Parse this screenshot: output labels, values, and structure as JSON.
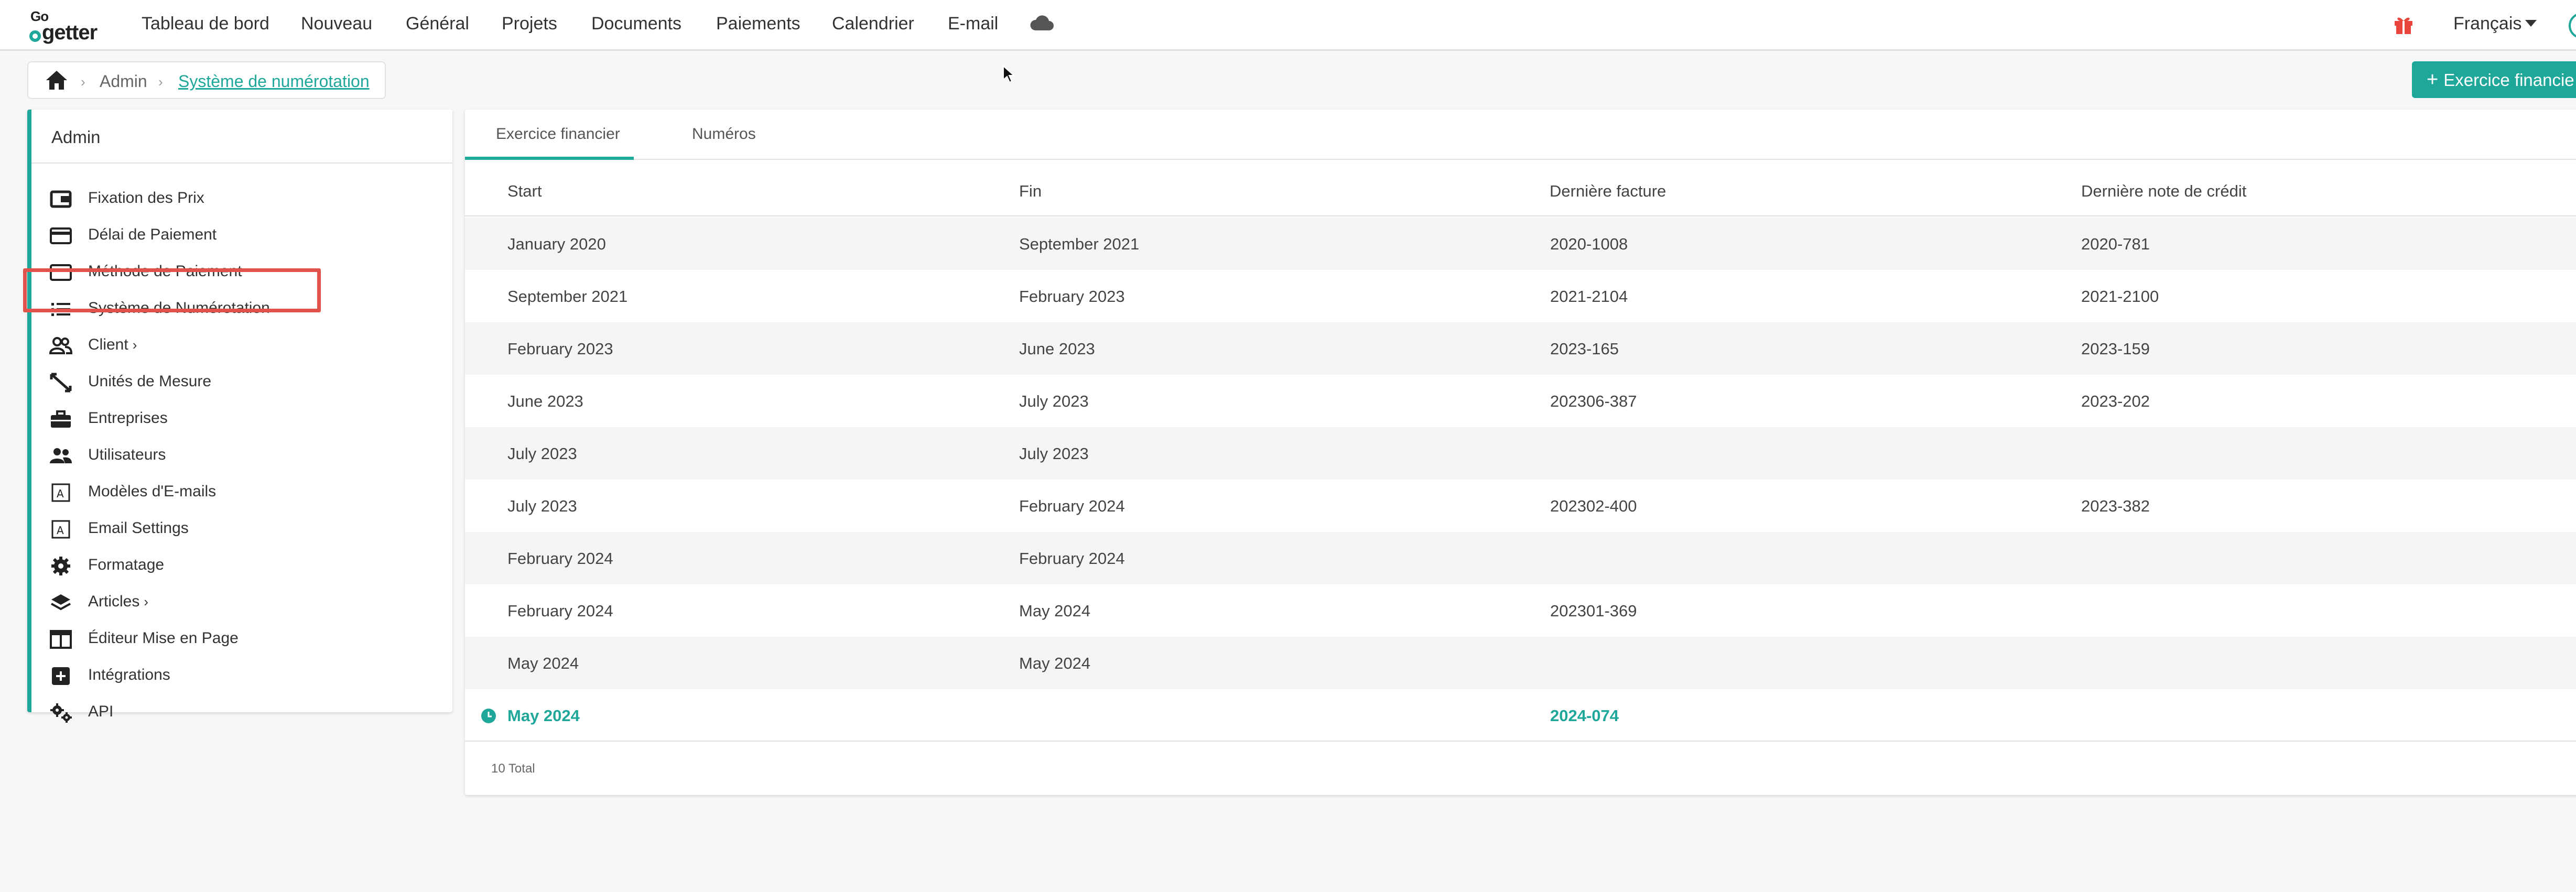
{
  "app": {
    "logo_top": "Go",
    "logo_bottom": "getter"
  },
  "nav": {
    "items": [
      "Tableau de bord",
      "Nouveau",
      "Général",
      "Projets",
      "Documents",
      "Paiements",
      "Calendrier",
      "E-mail"
    ],
    "cloud_icon": "cloud-icon",
    "gift_icon": "gift-icon",
    "language": "Français"
  },
  "breadcrumb": {
    "home_icon": "home-icon",
    "admin": "Admin",
    "current": "Système de numérotation"
  },
  "actions": {
    "new_fiscal_year": "Exercice financie"
  },
  "sidebar": {
    "title": "Admin",
    "items": [
      {
        "label": "Fixation des Prix",
        "icon": "wallet-icon"
      },
      {
        "label": "Délai de Paiement",
        "icon": "credit-card-icon"
      },
      {
        "label": "Méthode de Paiement",
        "icon": "credit-card-icon"
      },
      {
        "label": "Système de Numérotation",
        "icon": "list-icon"
      },
      {
        "label": "Client",
        "icon": "users-icon",
        "chevron": "›"
      },
      {
        "label": "Unités de Mesure",
        "icon": "ruler-icon"
      },
      {
        "label": "Entreprises",
        "icon": "briefcase-icon"
      },
      {
        "label": "Utilisateurs",
        "icon": "group-icon"
      },
      {
        "label": "Modèles d'E-mails",
        "icon": "template-icon"
      },
      {
        "label": "Email Settings",
        "icon": "template-icon"
      },
      {
        "label": "Formatage",
        "icon": "gear-icon"
      },
      {
        "label": "Articles",
        "icon": "layers-icon",
        "chevron": "›"
      },
      {
        "label": "Éditeur Mise en Page",
        "icon": "layout-icon"
      },
      {
        "label": "Intégrations",
        "icon": "plus-square-icon"
      },
      {
        "label": "API",
        "icon": "gears-icon"
      }
    ],
    "highlight_color": "#e0534a"
  },
  "main": {
    "tabs": [
      "Exercice financier",
      "Numéros"
    ],
    "columns": [
      "Start",
      "Fin",
      "Dernière facture",
      "Dernière note de crédit"
    ],
    "rows": [
      [
        "January 2020",
        "September 2021",
        "2020-1008",
        "2020-781"
      ],
      [
        "September 2021",
        "February 2023",
        "2021-2104",
        "2021-2100"
      ],
      [
        "February 2023",
        "June 2023",
        "2023-165",
        "2023-159"
      ],
      [
        "June 2023",
        "July 2023",
        "202306-387",
        "2023-202"
      ],
      [
        "July 2023",
        "July 2023",
        "",
        ""
      ],
      [
        "July 2023",
        "February 2024",
        "202302-400",
        "2023-382"
      ],
      [
        "February 2024",
        "February 2024",
        "",
        ""
      ],
      [
        "February 2024",
        "May 2024",
        "202301-369",
        ""
      ],
      [
        "May 2024",
        "May 2024",
        "",
        ""
      ],
      [
        "May 2024",
        "",
        "2024-074",
        ""
      ]
    ],
    "total": "10 Total"
  },
  "colors": {
    "accent": "#1fa79a",
    "highlight": "#e0534a",
    "gift": "#e8453c"
  }
}
